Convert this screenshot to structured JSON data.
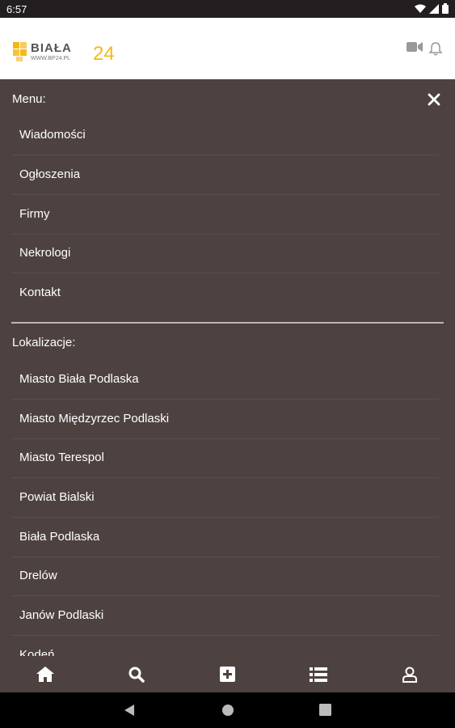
{
  "status_bar": {
    "time": "6:57"
  },
  "header": {
    "logo_text": "BIAŁA",
    "logo_number": "24",
    "logo_url_text": "WWW.BP24.PL"
  },
  "drawer": {
    "menu_title": "Menu:",
    "menu_items": [
      {
        "label": "Wiadomości"
      },
      {
        "label": "Ogłoszenia"
      },
      {
        "label": "Firmy"
      },
      {
        "label": "Nekrologi"
      },
      {
        "label": "Kontakt"
      }
    ],
    "locations_title": "Lokalizacje:",
    "location_items": [
      {
        "label": "Miasto Biała Podlaska"
      },
      {
        "label": "Miasto Międzyrzec Podlaski"
      },
      {
        "label": "Miasto Terespol"
      },
      {
        "label": "Powiat Bialski"
      },
      {
        "label": "Biała Podlaska"
      },
      {
        "label": "Drelów"
      },
      {
        "label": "Janów Podlaski"
      },
      {
        "label": "Kodeń"
      }
    ]
  },
  "bottom_nav": {
    "items": [
      {
        "icon": "home-icon"
      },
      {
        "icon": "search-icon"
      },
      {
        "icon": "add-icon"
      },
      {
        "icon": "list-icon",
        "active": true
      },
      {
        "icon": "user-icon"
      }
    ]
  },
  "colors": {
    "drawer_bg": "#4e4241",
    "logo_yellow": "#f5b819",
    "status_bar": "#231f20"
  }
}
